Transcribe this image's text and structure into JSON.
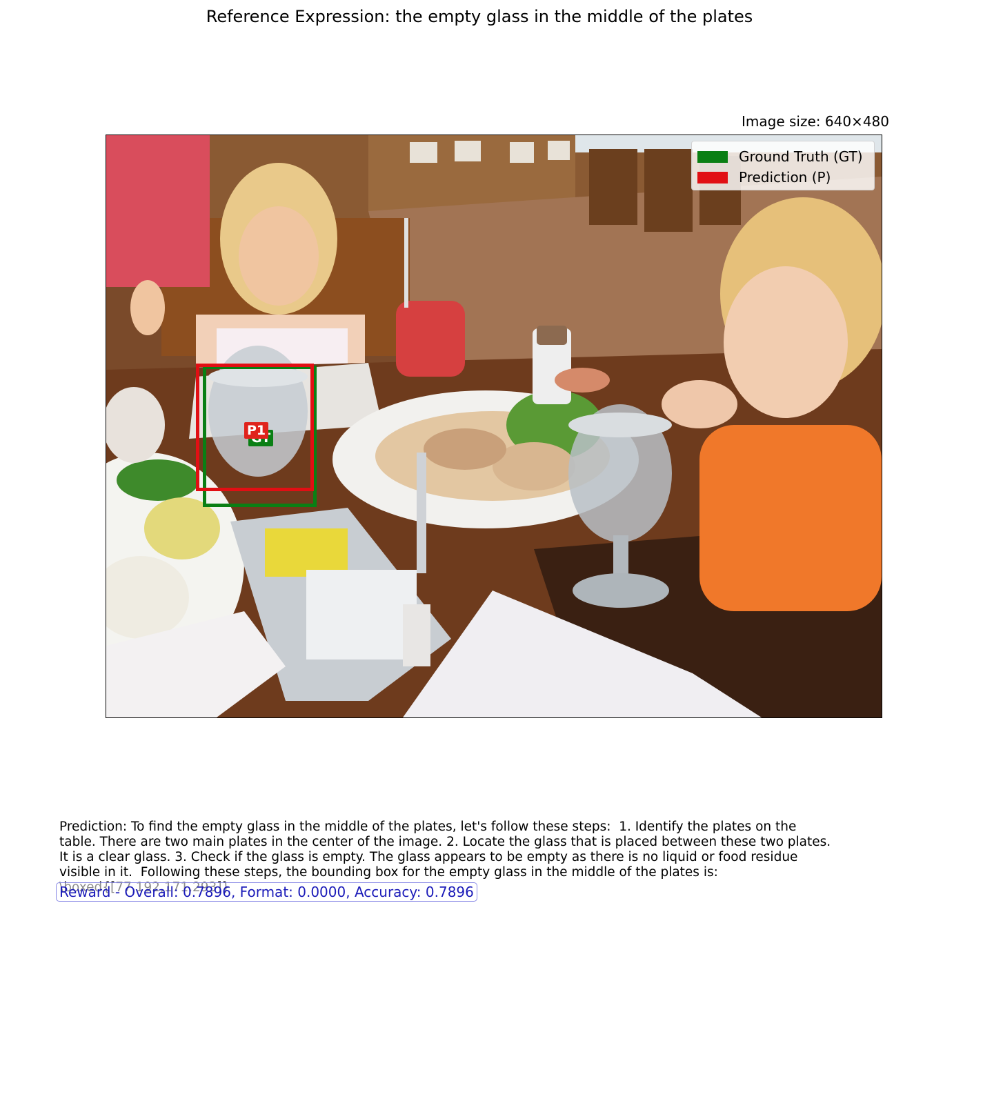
{
  "title": "Reference Expression: the empty glass in the middle of the plates",
  "image_size_label": "Image size: 640×480",
  "legend": {
    "items": [
      {
        "label": "Ground Truth (GT)",
        "color": "#0a7f14"
      },
      {
        "label": "Prediction (P)",
        "color": "#e10f14"
      }
    ]
  },
  "boxes": {
    "gt": {
      "tag": "GT",
      "color": "#0a7f14"
    },
    "pred": {
      "tag": "P1",
      "color": "#e10f14"
    }
  },
  "prediction_text": "Prediction: To find the empty glass in the middle of the plates, let's follow these steps:  1. Identify the plates on the table. There are two main plates in the center of the image. 2. Locate the glass that is placed between these two plates. It is a clear glass. 3. Check if the glass is empty. The glass appears to be empty as there is no liquid or food residue visible in it.  Following these steps, the bounding box for the empty glass in the middle of the plates is: \\boxed{[77,192,171,293]}",
  "reward_text": "Reward - Overall: 0.7896, Format: 0.0000, Accuracy: 0.7896"
}
